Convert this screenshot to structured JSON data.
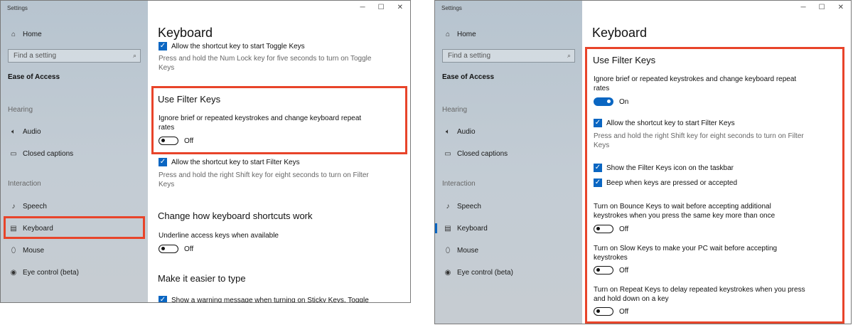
{
  "colors": {
    "accent": "#0a66c2",
    "callout": "#e8442a"
  },
  "left": {
    "window_title": "Settings",
    "sidebar": {
      "home": "Home",
      "search_placeholder": "Find a setting",
      "category": "Ease of Access",
      "hearing_label": "Hearing",
      "interaction_label": "Interaction",
      "items": [
        {
          "label": "Audio",
          "icon": "speaker-icon"
        },
        {
          "label": "Closed captions",
          "icon": "captions-icon"
        },
        {
          "label": "Speech",
          "icon": "microphone-icon"
        },
        {
          "label": "Keyboard",
          "icon": "keyboard-icon"
        },
        {
          "label": "Mouse",
          "icon": "mouse-icon"
        },
        {
          "label": "Eye control (beta)",
          "icon": "eye-control-icon"
        }
      ]
    },
    "page_title": "Keyboard",
    "toggle_keys": {
      "checkbox_label": "Allow the shortcut key to start Toggle Keys",
      "desc": "Press and hold the Num Lock key for five seconds to turn on Toggle Keys"
    },
    "filter_keys": {
      "title": "Use Filter Keys",
      "desc": "Ignore brief or repeated keystrokes and change keyboard repeat rates",
      "toggle_state": "Off",
      "checkbox_label": "Allow the shortcut key to start Filter Keys",
      "checkbox_desc": "Press and hold the right Shift key for eight seconds to turn on Filter Keys"
    },
    "shortcuts": {
      "title": "Change how keyboard shortcuts work",
      "desc": "Underline access keys when available",
      "toggle_state": "Off"
    },
    "easier": {
      "title": "Make it easier to type",
      "checkbox_label": "Show a warning message when turning on Sticky Keys, Toggle"
    }
  },
  "right": {
    "window_title": "Settings",
    "sidebar": {
      "home": "Home",
      "search_placeholder": "Find a setting",
      "category": "Ease of Access",
      "hearing_label": "Hearing",
      "interaction_label": "Interaction",
      "items": [
        {
          "label": "Audio"
        },
        {
          "label": "Closed captions"
        },
        {
          "label": "Speech"
        },
        {
          "label": "Keyboard"
        },
        {
          "label": "Mouse"
        },
        {
          "label": "Eye control (beta)"
        }
      ]
    },
    "page_title": "Keyboard",
    "filter_keys": {
      "title": "Use Filter Keys",
      "desc": "Ignore brief or repeated keystrokes and change keyboard repeat rates",
      "toggle_state": "On",
      "cb1_label": "Allow the shortcut key to start Filter Keys",
      "cb1_desc": "Press and hold the right Shift key for eight seconds to turn on Filter Keys",
      "cb2_label": "Show the Filter Keys icon on the taskbar",
      "cb3_label": "Beep when keys are pressed or accepted",
      "bounce_desc": "Turn on Bounce Keys to wait before accepting additional keystrokes when you press the same key more than once",
      "bounce_state": "Off",
      "slow_desc": "Turn on Slow Keys to make your PC wait before accepting keystrokes",
      "slow_state": "Off",
      "repeat_desc": "Turn on Repeat Keys to delay repeated keystrokes when you press and hold down on a key",
      "repeat_state": "Off"
    }
  }
}
